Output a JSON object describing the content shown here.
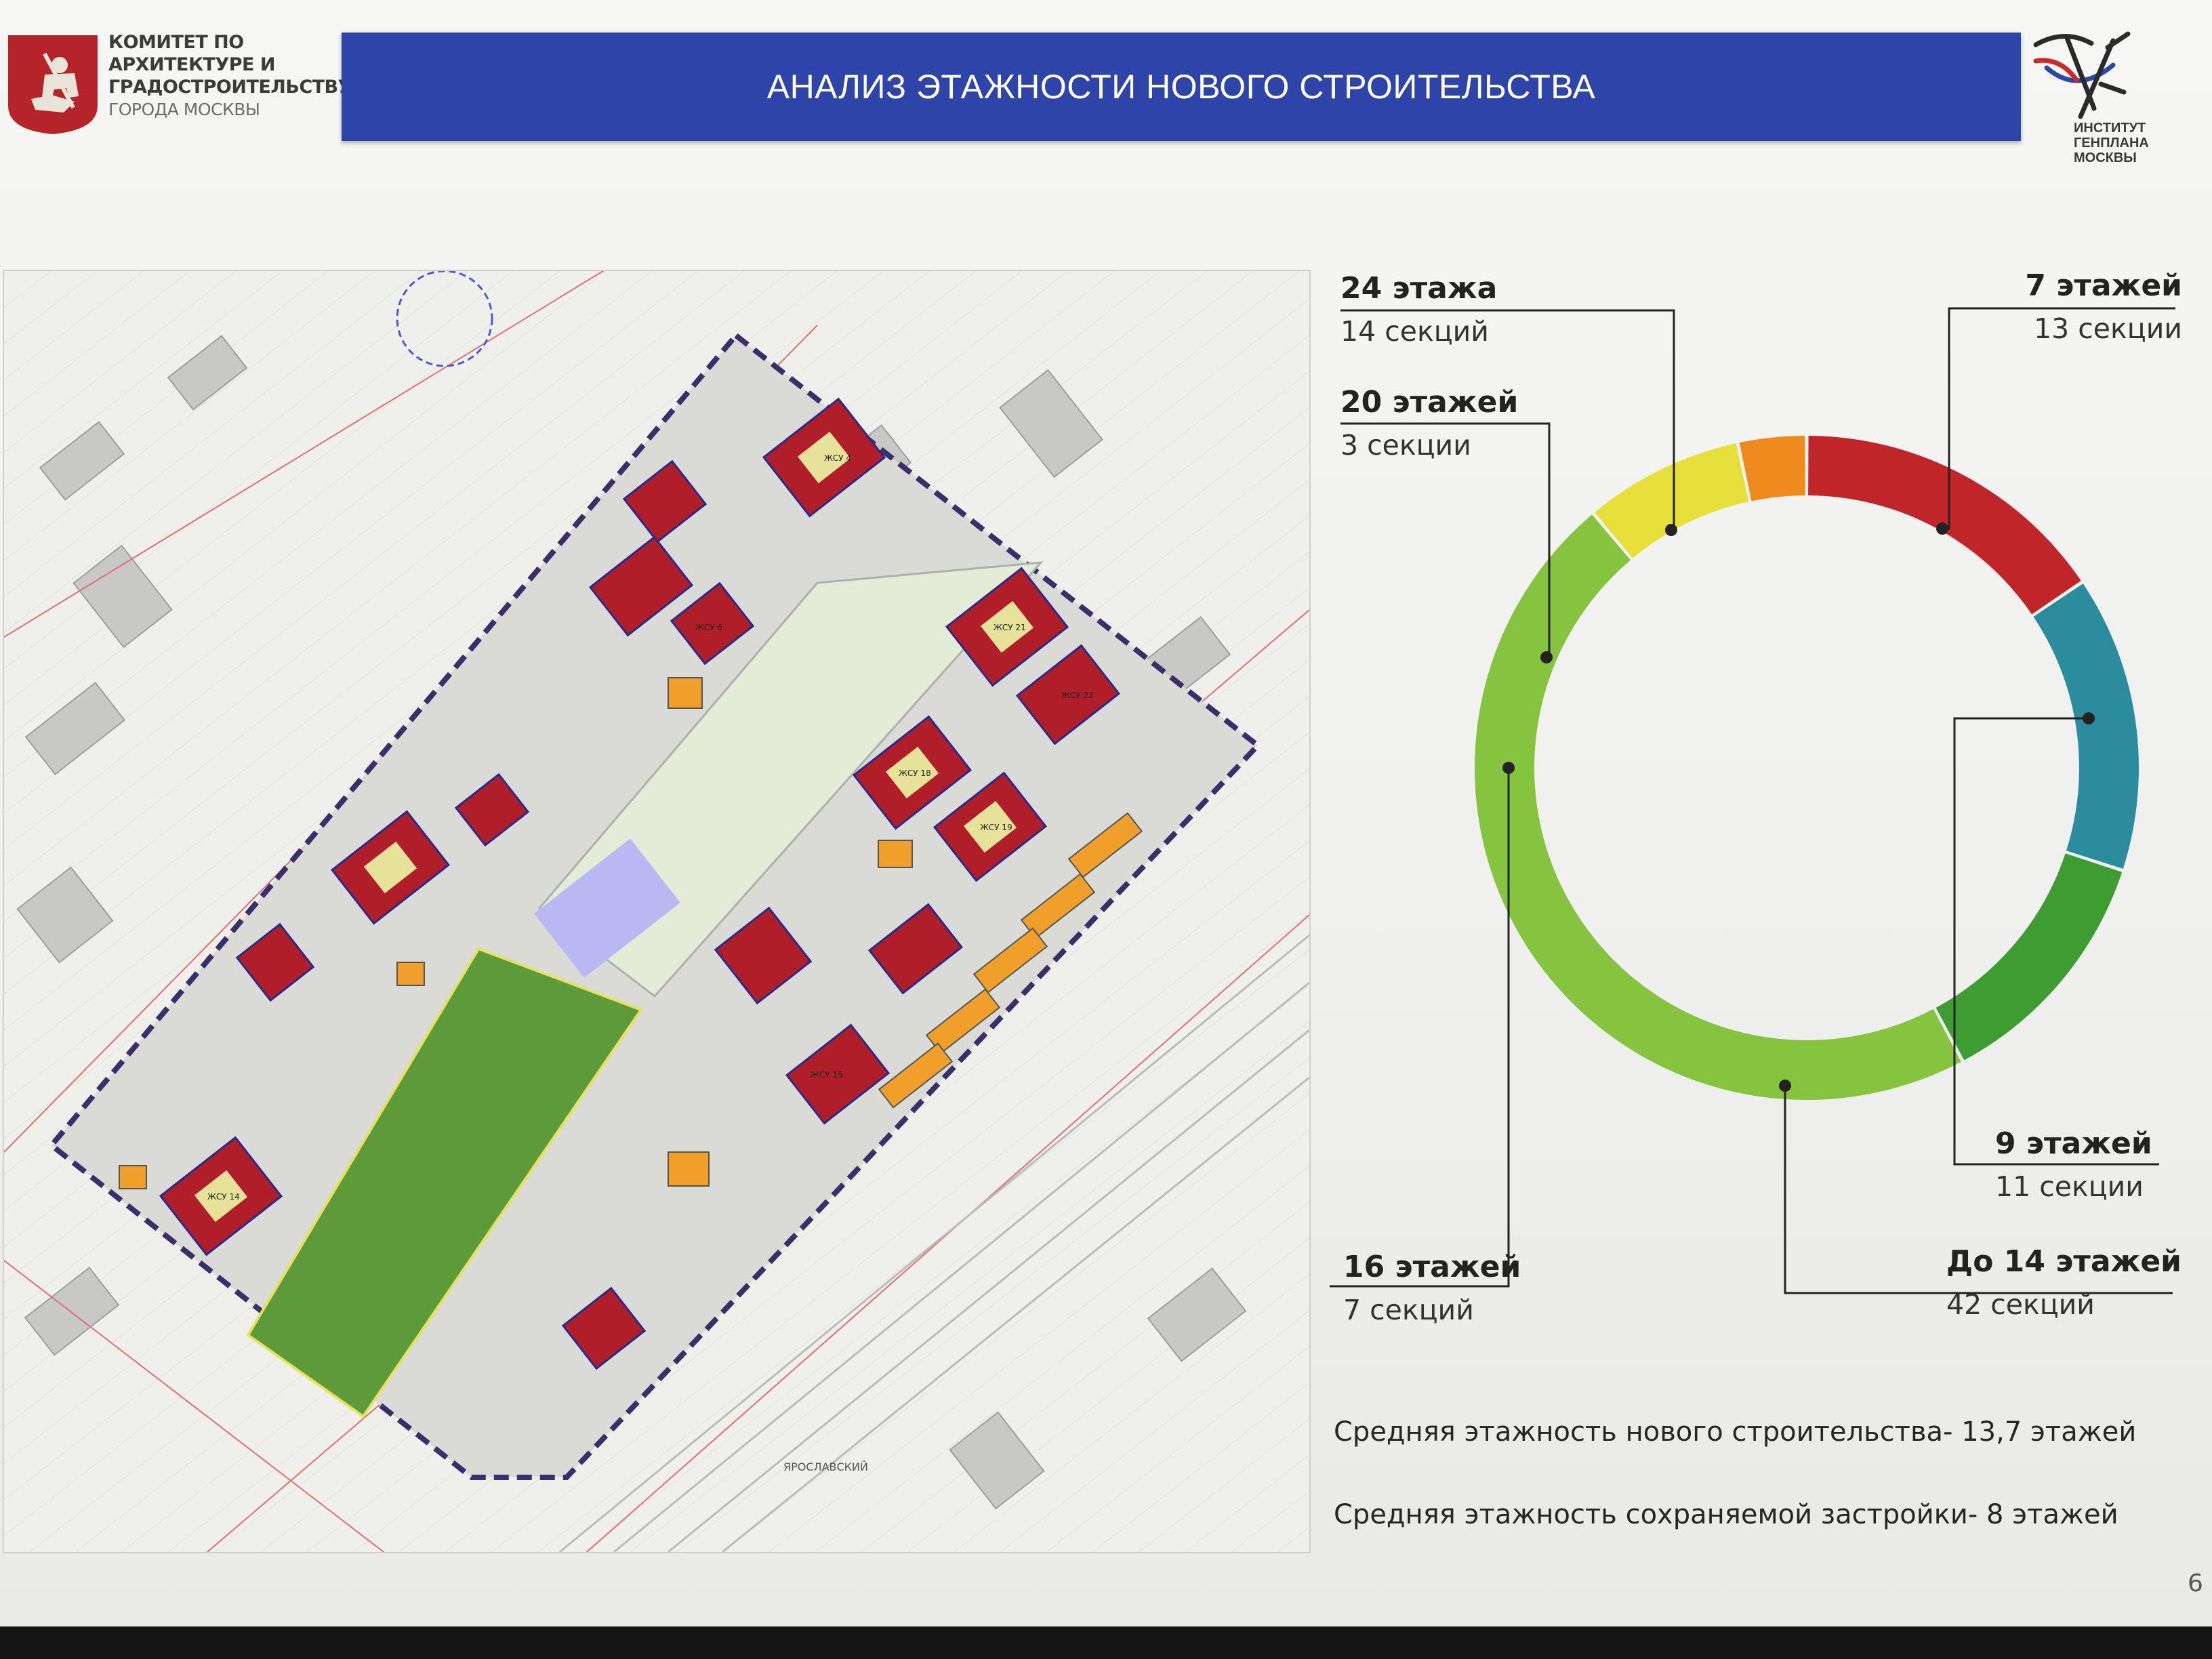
{
  "header": {
    "committee_lines": [
      "КОМИТЕТ ПО",
      "АРХИТЕКТУРЕ И",
      "ГРАДОСТРОИТЕЛЬСТВУ",
      "ГОРОДА МОСКВЫ"
    ],
    "title": "АНАЛИЗ ЭТАЖНОСТИ НОВОГО СТРОИТЕЛЬСТВА",
    "institute_lines": [
      "ИНСТИТУТ",
      "ГЕНПЛАНА",
      "МОСКВЫ"
    ]
  },
  "colors": {
    "title_bar": "#2e44a8",
    "floors_24": "#c0252a",
    "floors_20": "#ee8a1e",
    "floors_16": "#e7e03a",
    "floors_up_to_14": "#86c440",
    "floors_9": "#3e9c32",
    "floors_7": "#2a8c9c"
  },
  "chart_data": {
    "type": "pie",
    "donut": true,
    "unit": "секций",
    "slices": [
      {
        "key": "floors_24",
        "label": "24 этажа",
        "sub": "14 секций",
        "value": 14,
        "color": "#c0252a"
      },
      {
        "key": "floors_7",
        "label": "7 этажей",
        "sub": "13 секции",
        "value": 13,
        "color": "#2a8c9c"
      },
      {
        "key": "floors_9",
        "label": "9 этажей",
        "sub": "11 секции",
        "value": 11,
        "color": "#3e9c32"
      },
      {
        "key": "floors_up_to_14",
        "label": "До 14 этажей",
        "sub": "42 секций",
        "value": 42,
        "color": "#86c440"
      },
      {
        "key": "floors_16",
        "label": "16 этажей",
        "sub": "7 секций",
        "value": 7,
        "color": "#e7e03a"
      },
      {
        "key": "floors_20",
        "label": "20 этажей",
        "sub": "3 секции",
        "value": 3,
        "color": "#ee8a1e"
      }
    ]
  },
  "notes": {
    "avg_new": "Средняя этажность нового строительства- 13,7 этажей",
    "avg_kept": "Средняя этажность сохраняемой застройки- 8 этажей"
  },
  "page_number": "6",
  "map": {
    "districts": [
      "ЖСУ 4",
      "ЖСУ 6",
      "ЖСУ 21",
      "ЖСУ 22",
      "ЖСУ 18",
      "ЖСУ 19",
      "ЖСУ 15",
      "ЖСУ 14"
    ],
    "station_label": "ЯРОСЛАВСКИЙ"
  }
}
